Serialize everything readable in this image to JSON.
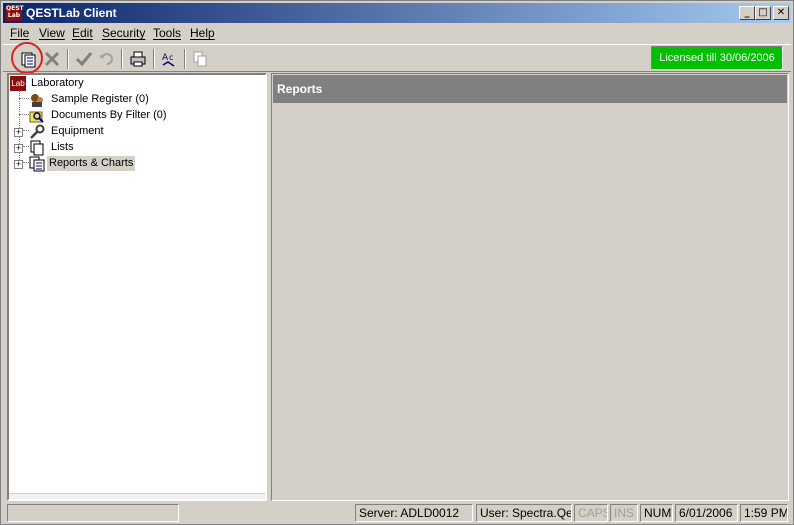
{
  "window": {
    "title": "QESTLab Client",
    "icon_text": "QEST Lab"
  },
  "menu": [
    "File",
    "View",
    "Edit",
    "Security",
    "Tools",
    "Help"
  ],
  "toolbar": {
    "license_text": "Licensed till 30/06/2006",
    "license_color": "#00c000",
    "buttons": [
      "new-document-icon",
      "delete-icon",
      "check-icon",
      "undo-icon",
      "print-icon",
      "spell-check-icon",
      "copy-icon"
    ]
  },
  "tree": {
    "root": {
      "badge": "Lab",
      "label": "Laboratory"
    },
    "items": [
      {
        "label": "Sample Register (0)",
        "icon": "sample-register-icon"
      },
      {
        "label": "Documents By Filter (0)",
        "icon": "documents-filter-icon"
      },
      {
        "label": "Equipment",
        "icon": "wrench-icon"
      },
      {
        "label": "Lists",
        "icon": "lists-icon"
      },
      {
        "label": "Reports & Charts",
        "icon": "reports-icon"
      }
    ]
  },
  "content": {
    "header": "Reports"
  },
  "status": {
    "server": "Server: ADLD0012",
    "user": "User: Spectra.Qest",
    "caps": "CAPS",
    "ins": "INS",
    "num": "NUM",
    "date": "6/01/2006",
    "time": "1:59 PM"
  }
}
